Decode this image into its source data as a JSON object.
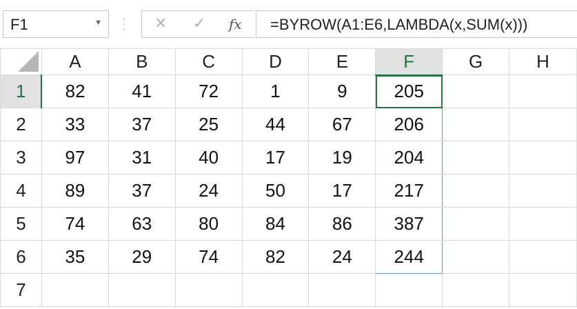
{
  "name_box": {
    "value": "F1"
  },
  "formula_bar": {
    "cancel_glyph": "✕",
    "enter_glyph": "✓",
    "fx_glyph": "fx",
    "formula": "=BYROW(A1:E6,LAMBDA(x,SUM(x)))"
  },
  "columns": [
    "A",
    "B",
    "C",
    "D",
    "E",
    "F",
    "G",
    "H"
  ],
  "rows": [
    {
      "label": "1",
      "cells": [
        "82",
        "41",
        "72",
        "1",
        "9",
        "205",
        "",
        ""
      ]
    },
    {
      "label": "2",
      "cells": [
        "33",
        "37",
        "25",
        "44",
        "67",
        "206",
        "",
        ""
      ]
    },
    {
      "label": "3",
      "cells": [
        "97",
        "31",
        "40",
        "17",
        "19",
        "204",
        "",
        ""
      ]
    },
    {
      "label": "4",
      "cells": [
        "89",
        "37",
        "24",
        "50",
        "17",
        "217",
        "",
        ""
      ]
    },
    {
      "label": "5",
      "cells": [
        "74",
        "63",
        "80",
        "84",
        "86",
        "387",
        "",
        ""
      ]
    },
    {
      "label": "6",
      "cells": [
        "35",
        "29",
        "74",
        "82",
        "24",
        "244",
        "",
        ""
      ]
    },
    {
      "label": "7",
      "cells": [
        "",
        "",
        "",
        "",
        "",
        "",
        "",
        ""
      ]
    }
  ],
  "selection": {
    "active_cell": "F1",
    "spill_range": "F1:F6"
  },
  "colors": {
    "accent": "#217346",
    "spill_border": "#6f8fc0",
    "header_selected_bg": "#e1e1e1"
  }
}
